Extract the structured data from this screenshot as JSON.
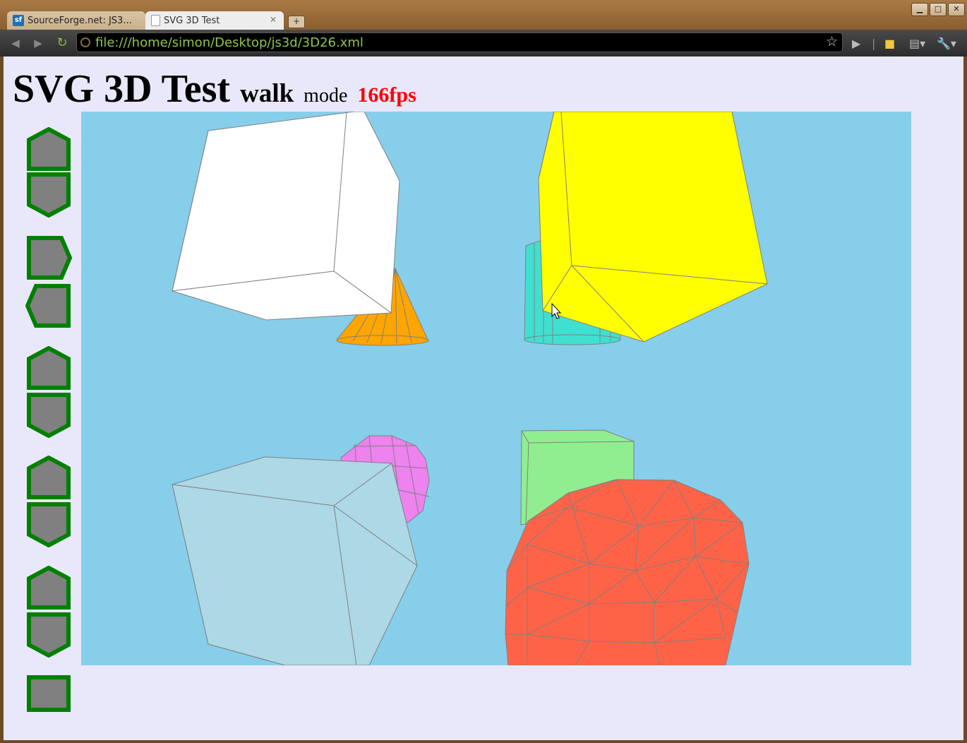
{
  "browser": {
    "tabs": [
      {
        "title": "SourceForge.net: JS3...",
        "favicon": "sourceforge-icon",
        "active": false
      },
      {
        "title": "SVG 3D Test",
        "favicon": "document-icon",
        "active": true
      }
    ],
    "url": "file:///home/simon/Desktop/js3d/3D26.xml"
  },
  "page": {
    "title": "SVG 3D Test",
    "mode_value": "walk",
    "mode_label": "mode",
    "fps": "166fps"
  },
  "colors": {
    "background": "#e8e8fa",
    "scene_background": "#87ceeb",
    "button_border": "#008000",
    "button_fill": "#808080",
    "fps": "#ff0000"
  },
  "controls": [
    {
      "name": "move-forward-button",
      "icon": "hexagon-up-icon"
    },
    {
      "name": "move-backward-button",
      "icon": "hexagon-down-icon"
    },
    {
      "name": "turn-right-button",
      "icon": "hexagon-right-icon"
    },
    {
      "name": "turn-left-button",
      "icon": "hexagon-left-icon"
    },
    {
      "name": "tilt-up-button",
      "icon": "hexagon-up-icon"
    },
    {
      "name": "tilt-down-button",
      "icon": "hexagon-down-icon"
    },
    {
      "name": "zoom-in-button",
      "icon": "hexagon-up-icon"
    },
    {
      "name": "zoom-out-button",
      "icon": "hexagon-down-icon"
    },
    {
      "name": "raise-button",
      "icon": "hexagon-up-icon"
    },
    {
      "name": "lower-button",
      "icon": "hexagon-down-icon"
    },
    {
      "name": "mode-toggle-button",
      "icon": "square-icon"
    }
  ],
  "scene": {
    "objects": [
      {
        "name": "white-cube",
        "fill": "#ffffff"
      },
      {
        "name": "orange-cone",
        "fill": "#ffa500"
      },
      {
        "name": "yellow-cube",
        "fill": "#ffff00"
      },
      {
        "name": "turquoise-cylinder",
        "fill": "#40e0d0"
      },
      {
        "name": "violet-sphere",
        "fill": "#ee82ee"
      },
      {
        "name": "lightblue-cube",
        "fill": "#add8e6"
      },
      {
        "name": "lightgreen-cube",
        "fill": "#90ee90"
      },
      {
        "name": "tomato-sphere",
        "fill": "#ff6347"
      }
    ],
    "edge_color": "#808080"
  }
}
